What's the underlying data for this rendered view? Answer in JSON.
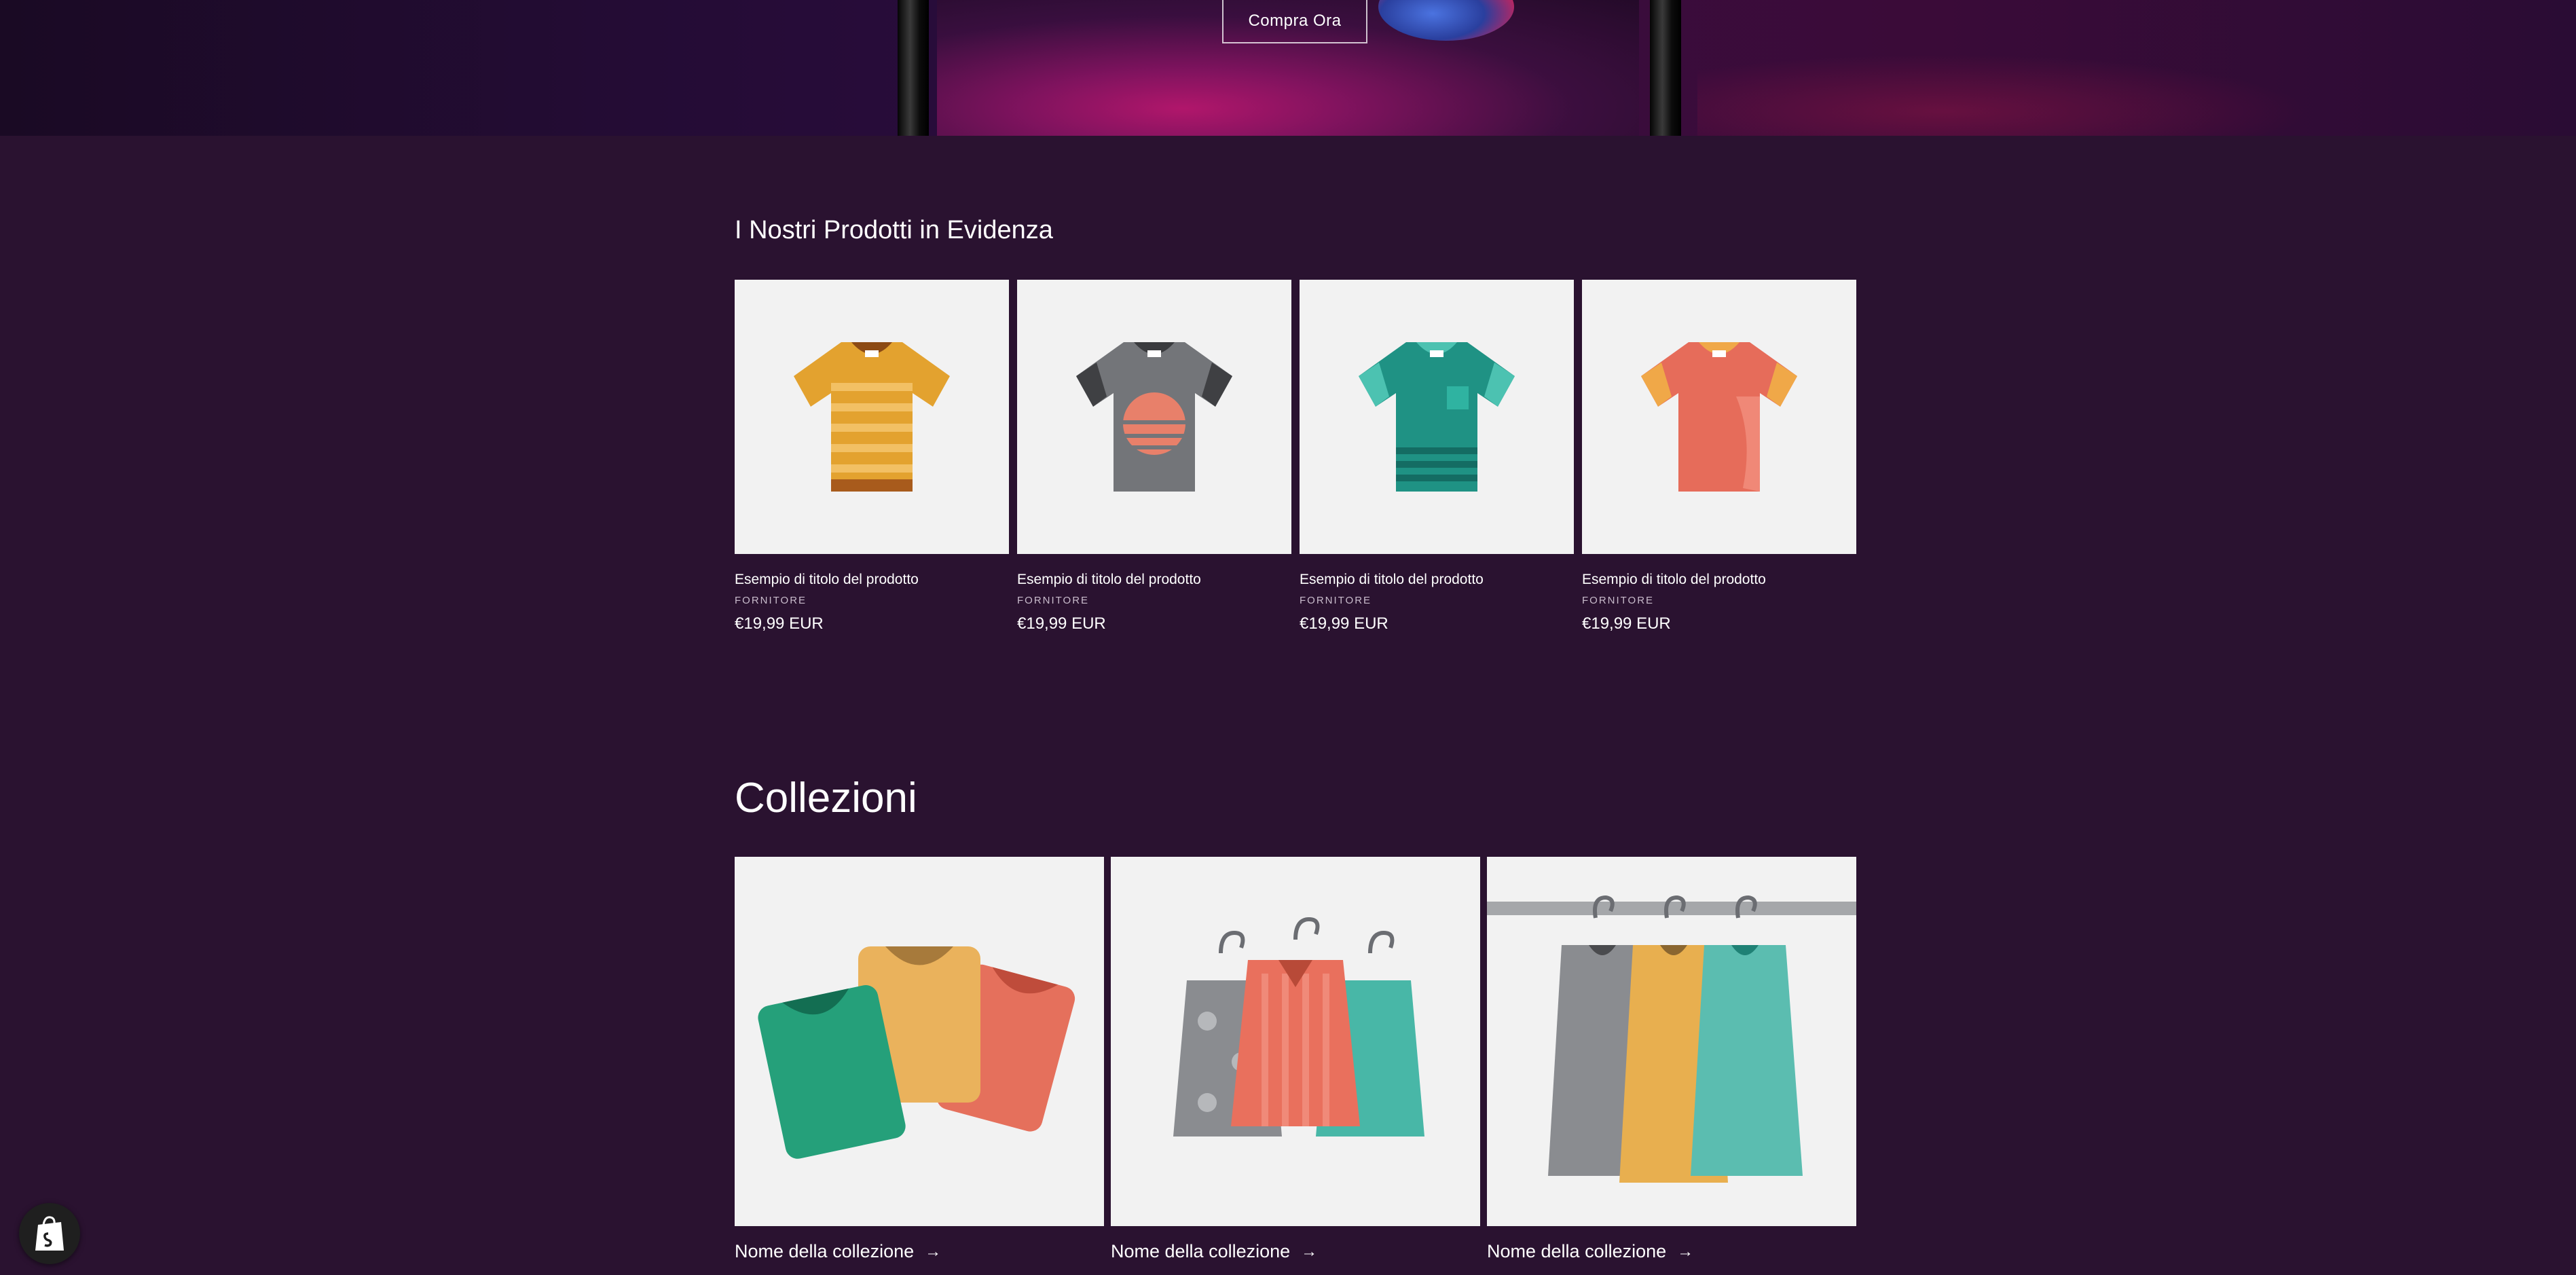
{
  "hero": {
    "cta_label": "Compra Ora"
  },
  "featured": {
    "title": "I Nostri Prodotti in Evidenza",
    "products": [
      {
        "name": "Esempio di titolo del prodotto",
        "vendor": "FORNITORE",
        "price": "€19,99 EUR",
        "icon": "striped-tshirt-icon"
      },
      {
        "name": "Esempio di titolo del prodotto",
        "vendor": "FORNITORE",
        "price": "€19,99 EUR",
        "icon": "sunset-tshirt-icon"
      },
      {
        "name": "Esempio di titolo del prodotto",
        "vendor": "FORNITORE",
        "price": "€19,99 EUR",
        "icon": "pocket-tshirt-icon"
      },
      {
        "name": "Esempio di titolo del prodotto",
        "vendor": "FORNITORE",
        "price": "€19,99 EUR",
        "icon": "plain-tshirt-icon"
      }
    ]
  },
  "collections": {
    "title": "Collezioni",
    "items": [
      {
        "label": "Nome della collezione",
        "icon": "folded-shirts-icon"
      },
      {
        "label": "Nome della collezione",
        "icon": "hanging-shirts-icon"
      },
      {
        "label": "Nome della collezione",
        "icon": "clothes-rack-icon"
      }
    ]
  },
  "colors": {
    "background": "#2a1230",
    "card_background": "#f2f2f2",
    "accent_magenta": "#c0167a"
  }
}
